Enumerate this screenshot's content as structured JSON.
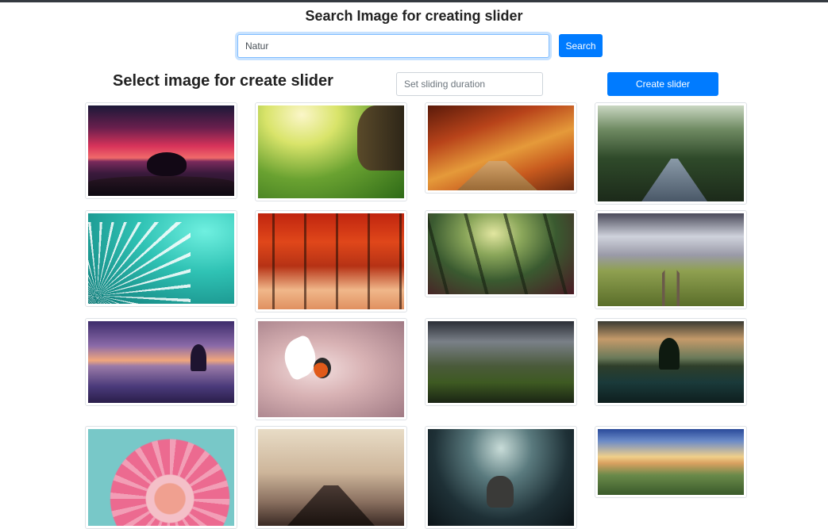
{
  "header": {
    "title": "Search Image for creating slider"
  },
  "search": {
    "value": "Natur",
    "button_label": "Search"
  },
  "controls": {
    "section_title": "Select image for create slider",
    "duration_placeholder": "Set sliding duration",
    "create_button_label": "Create slider"
  },
  "images": [
    {
      "subject": "sunset-tree"
    },
    {
      "subject": "meadow"
    },
    {
      "subject": "autumn-path"
    },
    {
      "subject": "forest-road"
    },
    {
      "subject": "dandelion"
    },
    {
      "subject": "autumn-forest"
    },
    {
      "subject": "misty-forest"
    },
    {
      "subject": "railway"
    },
    {
      "subject": "purple-lake"
    },
    {
      "subject": "bird"
    },
    {
      "subject": "dark-hills"
    },
    {
      "subject": "mountain-lake"
    },
    {
      "subject": "pink-flower"
    },
    {
      "subject": "foggy-pier"
    },
    {
      "subject": "elephant"
    },
    {
      "subject": "sky-valley"
    }
  ],
  "colors": {
    "primary": "#007bff",
    "focus_border": "#80bdff",
    "top_border": "#343a40"
  }
}
